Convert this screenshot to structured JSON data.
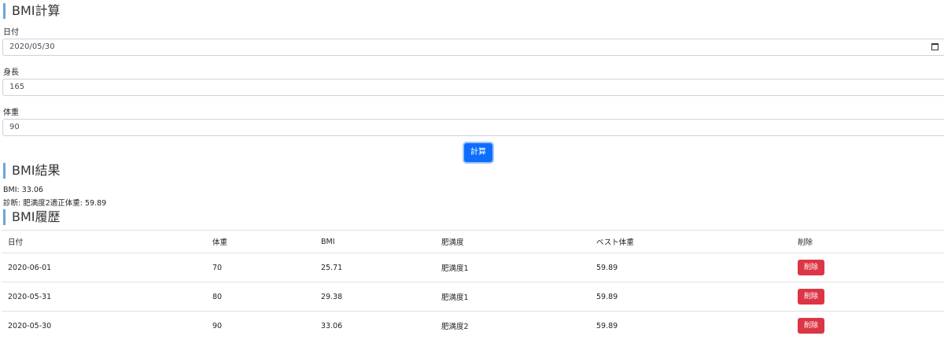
{
  "form": {
    "title": "BMI計算",
    "date_label": "日付",
    "date_value": "2020/05/30",
    "height_label": "身長",
    "height_value": "165",
    "weight_label": "体重",
    "weight_value": "90",
    "submit_label": "計算"
  },
  "result": {
    "title": "BMI結果",
    "bmi_line": "BMI: 33.06",
    "diagnosis_line": "診断: 肥満度2適正体重: 59.89"
  },
  "history": {
    "title": "BMI履歴",
    "columns": [
      "日付",
      "体重",
      "BMI",
      "肥満度",
      "ベスト体重",
      "削除"
    ],
    "rows": [
      {
        "date": "2020-06-01",
        "weight": "70",
        "bmi": "25.71",
        "level": "肥満度1",
        "best": "59.89",
        "delete_label": "削除"
      },
      {
        "date": "2020-05-31",
        "weight": "80",
        "bmi": "29.38",
        "level": "肥満度1",
        "best": "59.89",
        "delete_label": "削除"
      },
      {
        "date": "2020-05-30",
        "weight": "90",
        "bmi": "33.06",
        "level": "肥満度2",
        "best": "59.89",
        "delete_label": "削除"
      }
    ]
  },
  "colors": {
    "accent_bar": "#6ca6d9",
    "primary_button": "#0d6efd",
    "danger_button": "#dc3545"
  }
}
